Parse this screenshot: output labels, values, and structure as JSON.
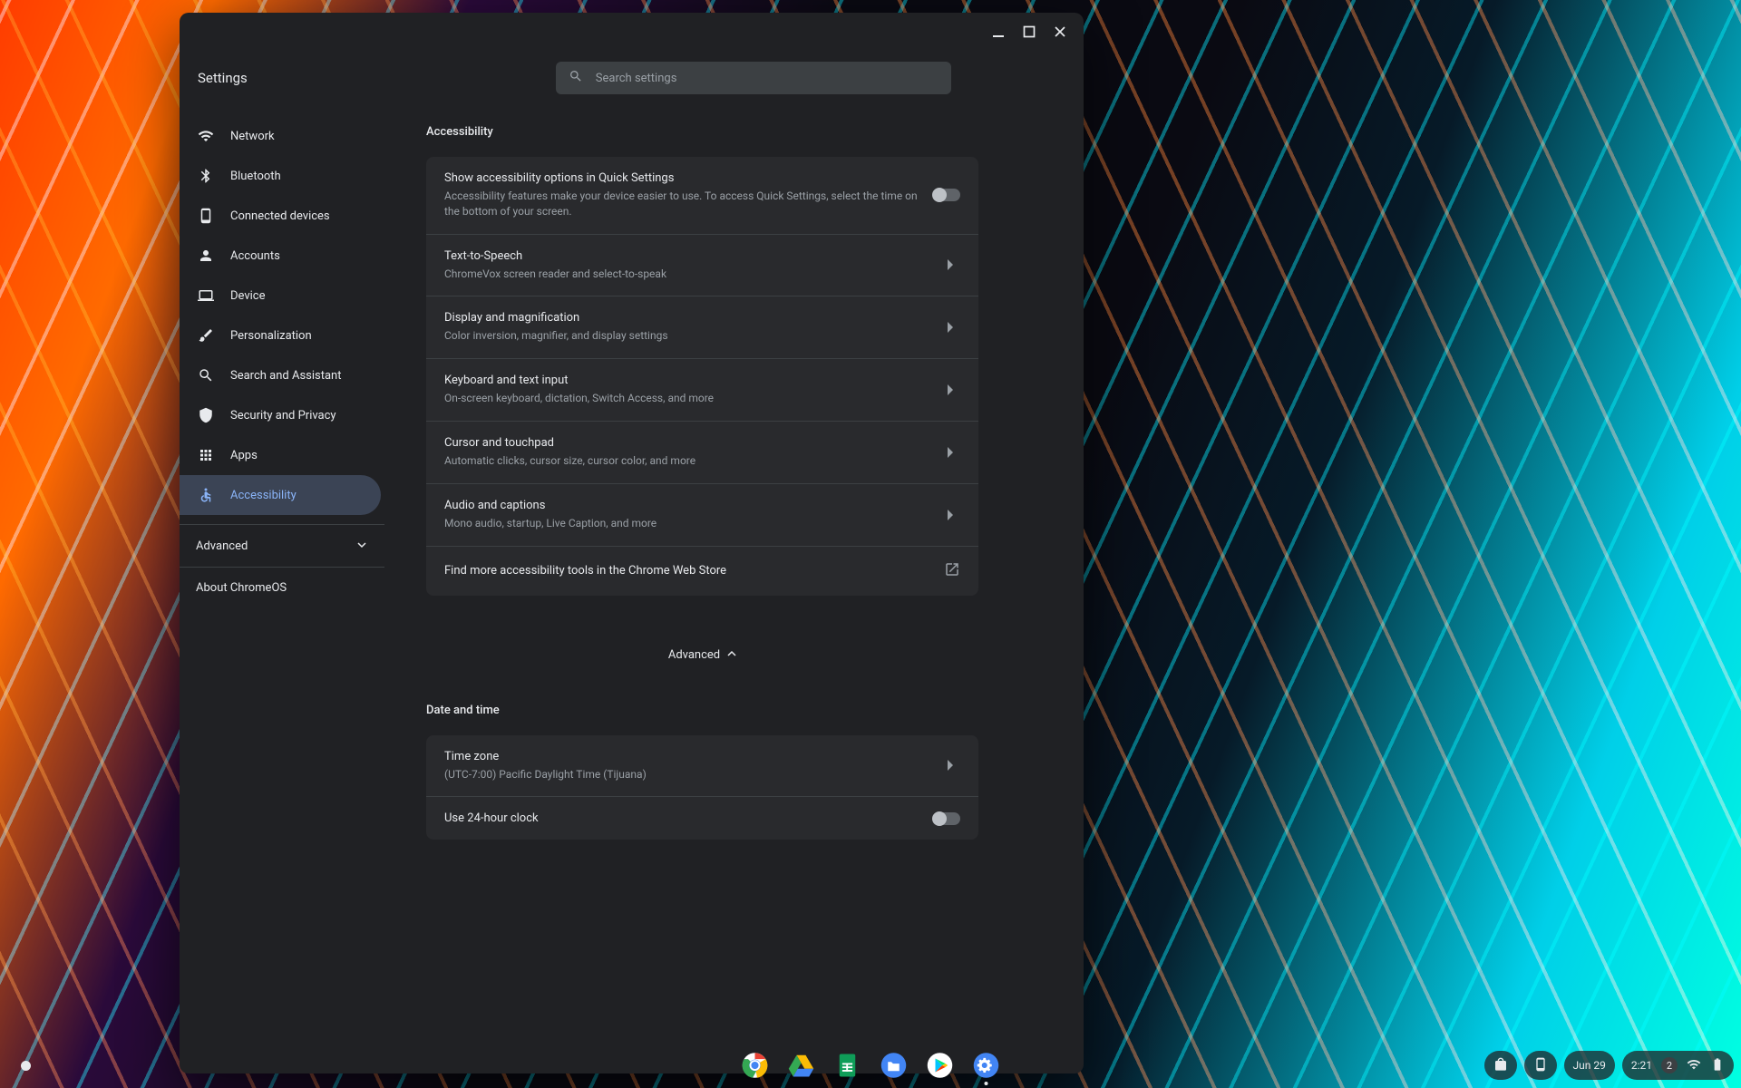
{
  "app_title": "Settings",
  "search": {
    "placeholder": "Search settings"
  },
  "sidebar": {
    "items": [
      {
        "label": "Network"
      },
      {
        "label": "Bluetooth"
      },
      {
        "label": "Connected devices"
      },
      {
        "label": "Accounts"
      },
      {
        "label": "Device"
      },
      {
        "label": "Personalization"
      },
      {
        "label": "Search and Assistant"
      },
      {
        "label": "Security and Privacy"
      },
      {
        "label": "Apps"
      },
      {
        "label": "Accessibility"
      }
    ],
    "advanced_label": "Advanced",
    "about_label": "About ChromeOS"
  },
  "accessibility": {
    "section_title": "Accessibility",
    "show_options": {
      "title": "Show accessibility options in Quick Settings",
      "sub": "Accessibility features make your device easier to use. To access Quick Settings, select the time on the bottom of your screen.",
      "on": false
    },
    "rows": [
      {
        "title": "Text-to-Speech",
        "sub": "ChromeVox screen reader and select-to-speak"
      },
      {
        "title": "Display and magnification",
        "sub": "Color inversion, magnifier, and display settings"
      },
      {
        "title": "Keyboard and text input",
        "sub": "On-screen keyboard, dictation, Switch Access, and more"
      },
      {
        "title": "Cursor and touchpad",
        "sub": "Automatic clicks, cursor size, cursor color, and more"
      },
      {
        "title": "Audio and captions",
        "sub": "Mono audio, startup, Live Caption, and more"
      }
    ],
    "webstore": "Find more accessibility tools in the Chrome Web Store"
  },
  "advanced_label": "Advanced",
  "datetime": {
    "section_title": "Date and time",
    "timezone": {
      "title": "Time zone",
      "sub": "(UTC-7:00) Pacific Daylight Time (Tijuana)"
    },
    "clock24": {
      "title": "Use 24-hour clock",
      "on": false
    }
  },
  "shelf": {
    "date": "Jun 29",
    "time": "2:21",
    "notifications": "2"
  }
}
